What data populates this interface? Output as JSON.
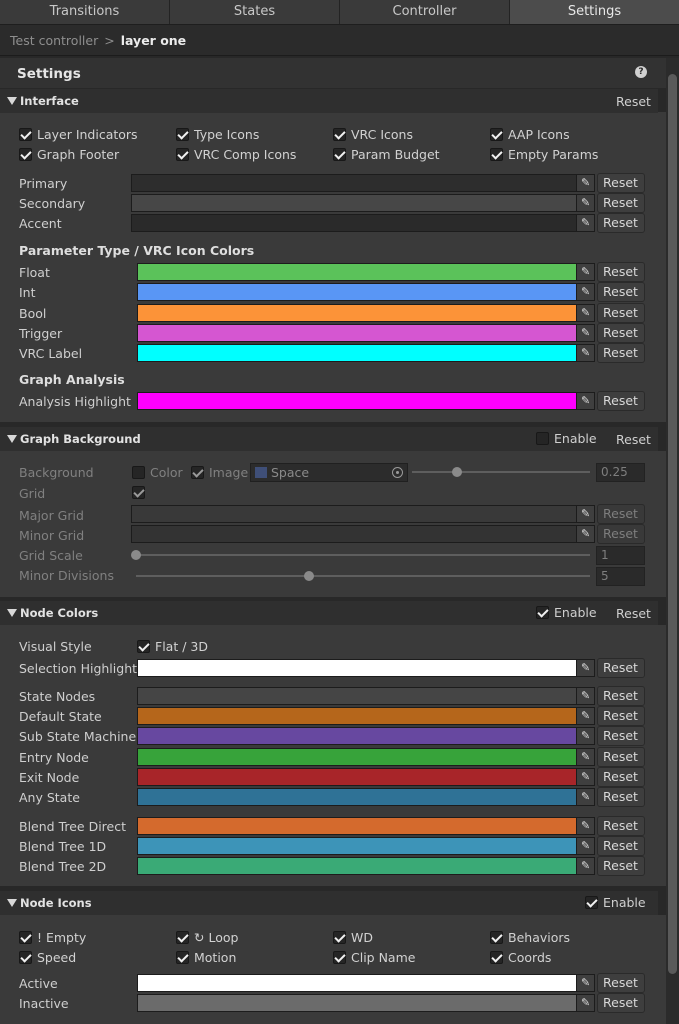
{
  "tabs": [
    {
      "label": "Transitions"
    },
    {
      "label": "States"
    },
    {
      "label": "Controller"
    },
    {
      "label": "Settings"
    }
  ],
  "breadcrumb": {
    "root": "Test controller",
    "separator": ">",
    "current": "layer one"
  },
  "settings_title": "Settings",
  "help_glyph": "?",
  "interface": {
    "title": "Interface",
    "reset": "Reset",
    "toggles": [
      {
        "label": "Layer Indicators",
        "checked": true
      },
      {
        "label": "Type Icons",
        "checked": true
      },
      {
        "label": "VRC Icons",
        "checked": true
      },
      {
        "label": "AAP Icons",
        "checked": true
      },
      {
        "label": "Graph Footer",
        "checked": true
      },
      {
        "label": "VRC Comp Icons",
        "checked": true
      },
      {
        "label": "Param Budget",
        "checked": true
      },
      {
        "label": "Empty Params",
        "checked": true
      }
    ],
    "theme_colors": [
      {
        "label": "Primary",
        "color": "#2d2d2d",
        "reset": "Reset"
      },
      {
        "label": "Secondary",
        "color": "#474747",
        "reset": "Reset"
      },
      {
        "label": "Accent",
        "color": "#2a2a2a",
        "reset": "Reset"
      }
    ],
    "param_colors_heading": "Parameter Type / VRC Icon Colors",
    "param_colors": [
      {
        "label": "Float",
        "color": "#5bc25a",
        "reset": "Reset"
      },
      {
        "label": "Int",
        "color": "#5996f5",
        "reset": "Reset"
      },
      {
        "label": "Bool",
        "color": "#fc9338",
        "reset": "Reset"
      },
      {
        "label": "Trigger",
        "color": "#d556d1",
        "reset": "Reset"
      },
      {
        "label": "VRC Label",
        "color": "#00ffff",
        "reset": "Reset"
      }
    ],
    "analysis_heading": "Graph Analysis",
    "analysis_colors": [
      {
        "label": "Analysis Highlight",
        "color": "#ff00ff",
        "reset": "Reset"
      }
    ]
  },
  "graph_background": {
    "title": "Graph Background",
    "enable_label": "Enable",
    "enabled": false,
    "reset": "Reset",
    "background_label": "Background",
    "color_toggle": "Color",
    "image_toggle": "Image",
    "image_field": "Space",
    "image_value": "0.25",
    "image_value_fraction": 0.25,
    "grid_label": "Grid",
    "major_grid_label": "Major Grid",
    "minor_grid_label": "Minor Grid",
    "major_grid_color": "#393939",
    "minor_grid_color": "#333333",
    "grid_reset": "Reset",
    "grid_scale_label": "Grid Scale",
    "grid_scale_value": "1",
    "grid_scale_fraction": 0.0,
    "minor_divisions_label": "Minor Divisions",
    "minor_divisions_value": "5",
    "minor_divisions_fraction": 0.38
  },
  "node_colors": {
    "title": "Node Colors",
    "enable_label": "Enable",
    "enabled": true,
    "reset": "Reset",
    "visual_style_label": "Visual Style",
    "visual_style_toggle": "Flat / 3D",
    "selection_highlight": {
      "label": "Selection Highlight",
      "color": "#ffffff",
      "reset": "Reset"
    },
    "state_colors": [
      {
        "label": "State Nodes",
        "color": "#454545",
        "reset": "Reset"
      },
      {
        "label": "Default State",
        "color": "#b5661b",
        "reset": "Reset"
      },
      {
        "label": "Sub State Machine",
        "color": "#6748a0",
        "reset": "Reset"
      },
      {
        "label": "Entry Node",
        "color": "#37a33a",
        "reset": "Reset"
      },
      {
        "label": "Exit Node",
        "color": "#a82529",
        "reset": "Reset"
      },
      {
        "label": "Any State",
        "color": "#2f7296",
        "reset": "Reset"
      }
    ],
    "blend_colors": [
      {
        "label": "Blend Tree Direct",
        "color": "#d46a2d",
        "reset": "Reset"
      },
      {
        "label": "Blend Tree 1D",
        "color": "#3d94b8",
        "reset": "Reset"
      },
      {
        "label": "Blend Tree 2D",
        "color": "#3aaa76",
        "reset": "Reset"
      }
    ]
  },
  "node_icons": {
    "title": "Node Icons",
    "enable_label": "Enable",
    "enabled": true,
    "toggles": [
      {
        "label": "! Empty",
        "checked": true
      },
      {
        "label": "↻ Loop",
        "checked": true
      },
      {
        "label": "WD",
        "checked": true
      },
      {
        "label": "Behaviors",
        "checked": true
      },
      {
        "label": "Speed",
        "checked": true
      },
      {
        "label": "Motion",
        "checked": true
      },
      {
        "label": "Clip Name",
        "checked": true
      },
      {
        "label": "Coords",
        "checked": true
      }
    ],
    "colors": [
      {
        "label": "Active",
        "color": "#ffffff",
        "reset": "Reset"
      },
      {
        "label": "Inactive",
        "color": "#6b6b6b",
        "reset": "Reset"
      }
    ]
  }
}
